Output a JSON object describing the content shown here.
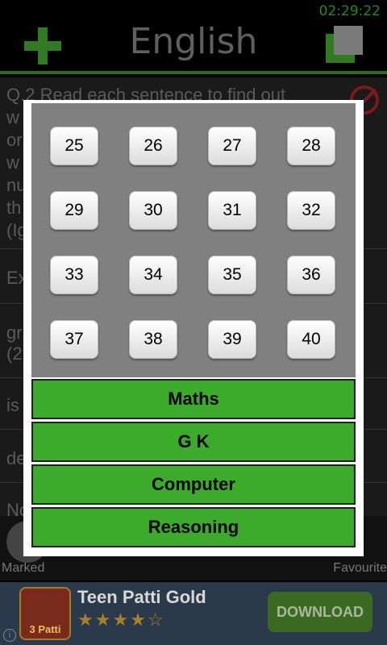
{
  "status": {
    "time": "02:29:22"
  },
  "app": {
    "title": "English"
  },
  "question": {
    "text": "Q.2  Read each sentence to find out whether there is any grammatical error or idiomatic error in it. The error, if any, will be in one part of the sentence. The number of that part is the answer. (Ignore the errors of punctuation, if any.)",
    "lines": [
      "Q.2  Read each sentence to find out",
      "w",
      "or",
      "w",
      "nu",
      "th",
      "(Ig"
    ]
  },
  "options": {
    "visible_fragments": [
      "Ex",
      "gr",
      "(2",
      "is",
      "de",
      "No"
    ]
  },
  "bottom_nav": {
    "marked_label": "Marked",
    "favourite_label": "Favourite"
  },
  "ad": {
    "title": "Teen Patti Gold",
    "stars": "★★★★☆",
    "download_label": "DOWNLOAD",
    "logo_text": "3 Patti",
    "info": "i"
  },
  "dialog": {
    "numbers": [
      "25",
      "26",
      "27",
      "28",
      "29",
      "30",
      "31",
      "32",
      "33",
      "34",
      "35",
      "36",
      "37",
      "38",
      "39",
      "40"
    ],
    "subjects": [
      "Maths",
      "G K",
      "Computer",
      "Reasoning"
    ]
  }
}
